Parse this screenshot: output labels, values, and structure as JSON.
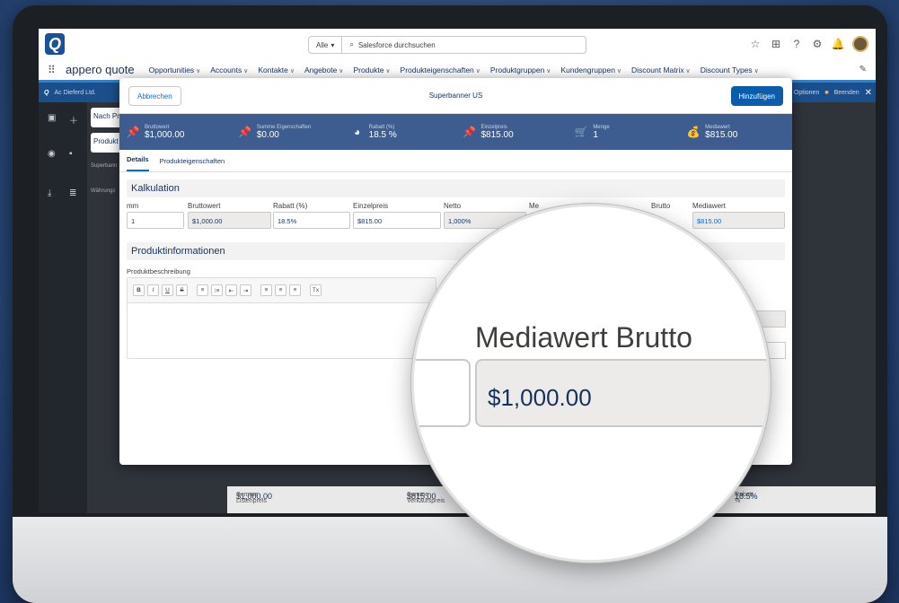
{
  "header": {
    "search_scope": "Alle",
    "search_placeholder": "Salesforce durchsuchen"
  },
  "nav": {
    "app_name": "appero quote",
    "items": [
      "Opportunities",
      "Accounts",
      "Kontakte",
      "Angebote",
      "Produkte",
      "Produkteigenschaften",
      "Produktgruppen",
      "Kundengruppen",
      "Discount Matrix",
      "Discount Types"
    ]
  },
  "subbar": {
    "left": "Ac Dieferd Ltd.",
    "options": "Optionen",
    "end": "Beenden"
  },
  "background": {
    "card1": "Nach Pr",
    "card2": "Produkt",
    "row1": "Superbann",
    "row2": "Währungs",
    "footer": [
      {
        "label": "Summe Listenpreis",
        "value": "$1,000.00"
      },
      {
        "label": "Summe Verkaufspreis",
        "value": "$815.00"
      },
      {
        "label": "Rabatt %",
        "value": "18.5%"
      }
    ]
  },
  "modal": {
    "cancel": "Abbrechen",
    "title": "Superbanner US",
    "add": "Hinzufügen",
    "kpis": [
      {
        "label": "Bruttowert",
        "value": "$1,000.00",
        "icon": "pin-icon"
      },
      {
        "label": "Summe Eigenschaften",
        "value": "$0.00",
        "icon": "pin-icon"
      },
      {
        "label": "Rabatt (%)",
        "value": "18.5 %",
        "icon": "pie-chart-icon"
      },
      {
        "label": "Einzelpreis",
        "value": "$815.00",
        "icon": "pin-icon"
      },
      {
        "label": "Menge",
        "value": "1",
        "icon": "cart-icon"
      },
      {
        "label": "Mediawert",
        "value": "$815.00",
        "icon": "money-bag-icon"
      }
    ],
    "tabs": [
      "Details",
      "Produkteigenschaften"
    ],
    "section_kalkulation": "Kalkulation",
    "fields": {
      "mm": {
        "label": "mm",
        "value": "1"
      },
      "bruttowert": {
        "label": "Bruttowert",
        "value": "$1,000.00"
      },
      "rabatt": {
        "label": "Rabatt (%)",
        "value": "18.5%"
      },
      "einzelpreis": {
        "label": "Einzelpreis",
        "value": "$815.00"
      },
      "netto": {
        "label": "Netto",
        "value": "1,000%"
      },
      "me": {
        "label": "Me"
      },
      "brutto": {
        "label": "Brutto"
      },
      "mediawert": {
        "label": "Mediawert",
        "value": "$815.00"
      }
    },
    "section_produktinfo": "Produktinformationen",
    "desc_label": "Produktbeschreibung",
    "toolbar": [
      "B",
      "I",
      "U",
      "S",
      "≡",
      "⁝≡",
      "⇤",
      "⇥",
      "≡",
      "≡",
      "≡",
      "Tx"
    ]
  },
  "magnifier": {
    "label": "Mediawert Brutto",
    "value": "$1,000.00"
  }
}
